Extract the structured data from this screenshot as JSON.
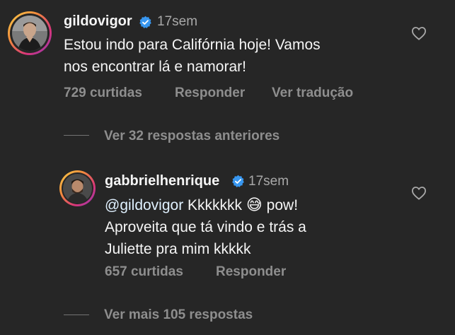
{
  "comment": {
    "username": "gildovigor",
    "time": "17sem",
    "text_line1": "Estou indo para Califórnia hoje! Vamos",
    "text_line2": "nos encontrar lá e namorar!",
    "likes": "729 curtidas",
    "reply": "Responder",
    "translate": "Ver tradução"
  },
  "previous_replies": "Ver 32 respostas anteriores",
  "reply": {
    "username": "gabbrielhenrique",
    "time": "17sem",
    "mention": "@gildovigor",
    "text_line1_rest": " Kkkkkkk ",
    "text_line1_end": " pow!",
    "text_line2": "Aproveita que tá vindo e trás a",
    "text_line3": "Juliette pra mim kkkkk",
    "emoji": "😅",
    "likes": "657 curtidas",
    "reply": "Responder"
  },
  "more_replies": "Ver mais 105 respostas",
  "icons": {
    "verified": "verified-badge-icon",
    "like": "heart-outline-icon"
  },
  "colors": {
    "background": "#262626",
    "verified": "#3897f0",
    "secondary_text": "#8e8e8e"
  }
}
